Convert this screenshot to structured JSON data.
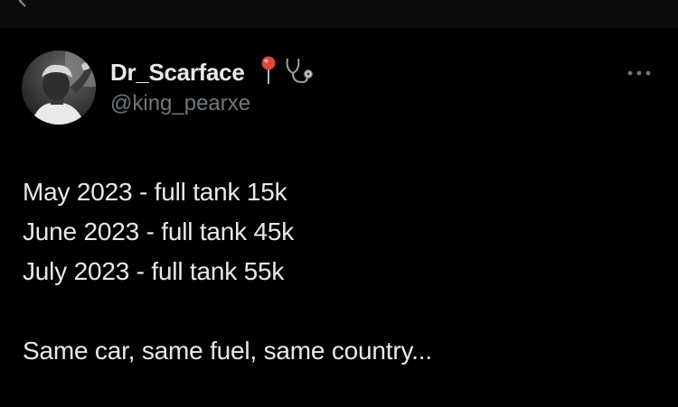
{
  "author": {
    "display_name": "Dr_Scarface",
    "handle": "@king_pearxe",
    "name_emojis": [
      "pushpin-icon",
      "stethoscope-icon"
    ]
  },
  "tweet": {
    "lines": [
      "May 2023 - full tank 15k",
      "June 2023 - full tank 45k",
      "July 2023 - full tank 55k",
      "",
      "Same car, same fuel, same country..."
    ]
  },
  "colors": {
    "background": "#000000",
    "text_primary": "#e7e9ea",
    "text_secondary": "#71767b"
  }
}
